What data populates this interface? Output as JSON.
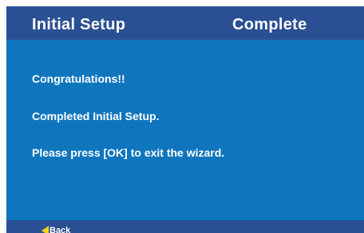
{
  "header": {
    "title": "Initial Setup",
    "status": "Complete"
  },
  "main": {
    "messages": [
      "Congratulations!!",
      "Completed Initial Setup.",
      "Please press [OK] to exit the wizard."
    ]
  },
  "footer": {
    "back_label": "Back",
    "back_icon": "back-arrow-icon"
  },
  "colors": {
    "header_bg": "#2b4f93",
    "body_bg": "#0f76be",
    "text": "#ffffff",
    "back_arrow": "#f2d21a"
  }
}
